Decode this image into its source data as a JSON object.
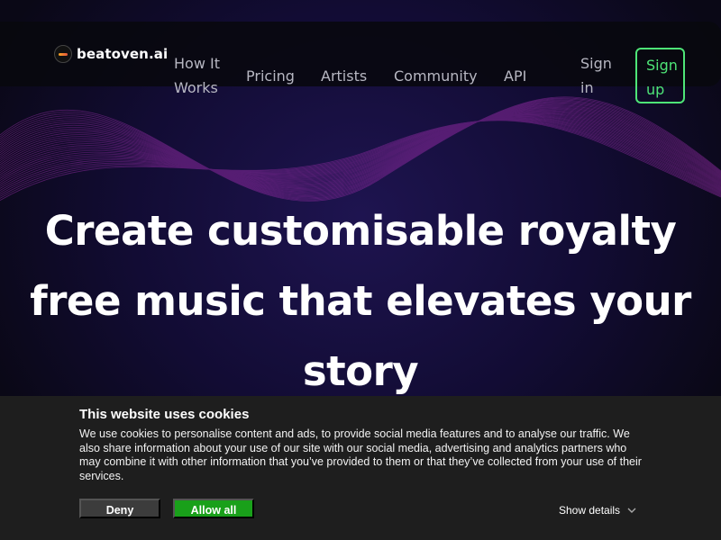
{
  "brand": {
    "name": "beatoven.ai",
    "icon": "beatoven-logo-icon"
  },
  "nav": {
    "links": [
      "How It Works",
      "Pricing",
      "Artists",
      "Community",
      "API"
    ],
    "sign_in": "Sign in",
    "sign_up": "Sign up"
  },
  "hero": {
    "headline": "Create customisable royalty free music that elevates your story"
  },
  "cookies": {
    "title": "This website uses cookies",
    "text": "We use cookies to personalise content and ads, to provide social media features and to analyse our traffic. We also share information about your use of our site with our social media, advertising and analytics partners who may combine it with other information that you’ve provided to them or that they’ve collected from your use of their services.",
    "deny": "Deny",
    "allow_all": "Allow all",
    "show_details": "Show details",
    "details_icon": "chevron-down-icon"
  },
  "colors": {
    "accent": "#4ee577",
    "allow_button": "#19a01a",
    "banner_bg": "#1e1e1e",
    "hero_bg": "#120c34",
    "wave": "#8b2a9e"
  }
}
